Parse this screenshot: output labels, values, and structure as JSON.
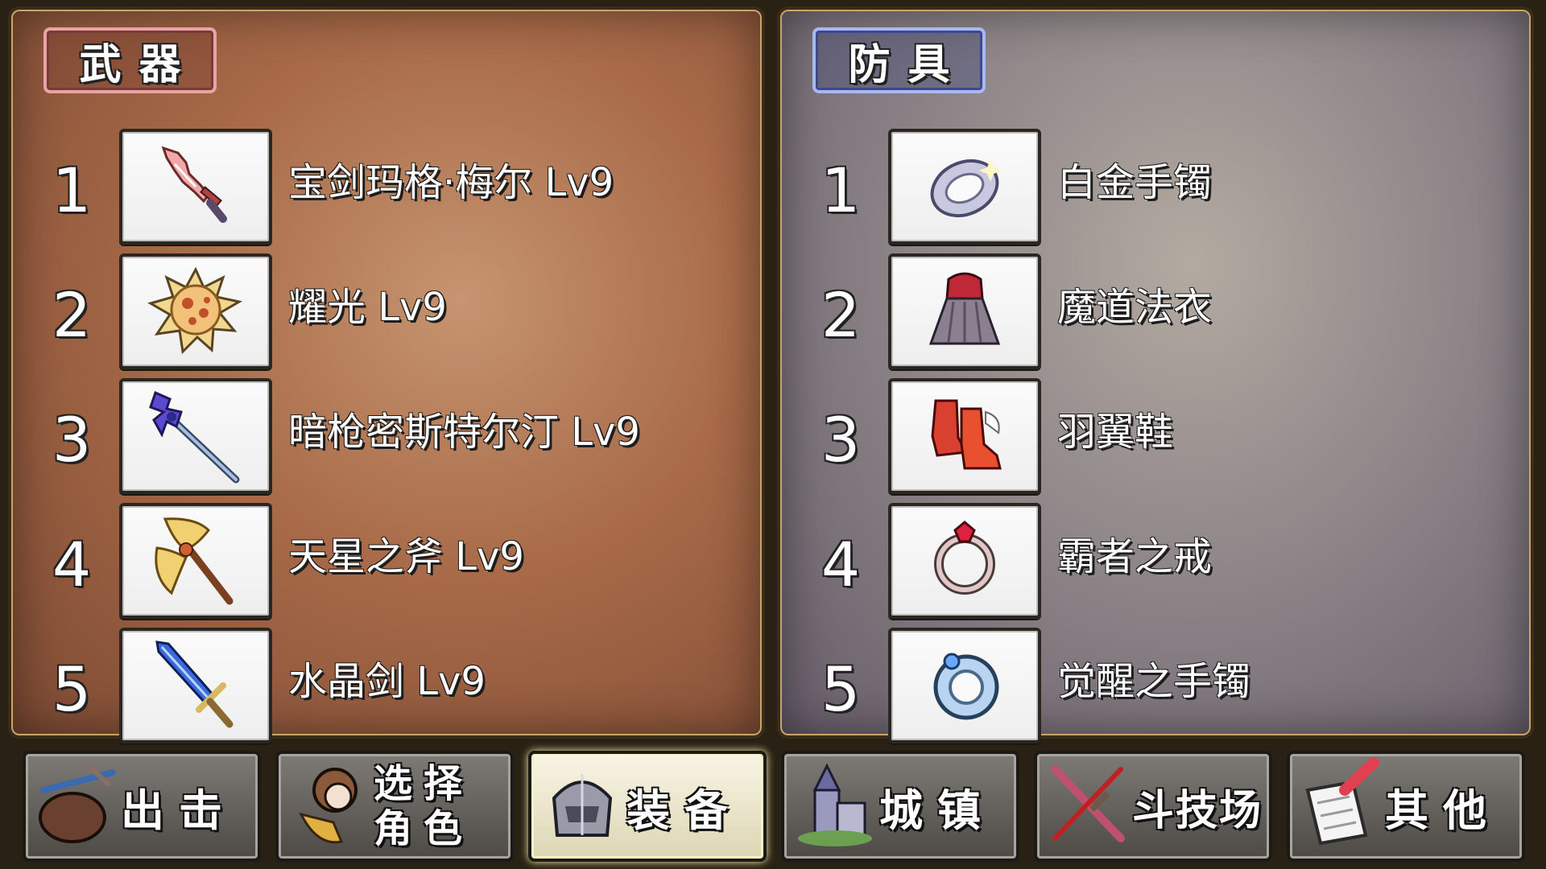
{
  "weapons": {
    "title": "武器",
    "items": [
      {
        "num": "1",
        "name": "宝剑玛格·梅尔 Lv9",
        "icon": "sword-icon"
      },
      {
        "num": "2",
        "name": "耀光 Lv9",
        "icon": "flare-orb-icon"
      },
      {
        "num": "3",
        "name": "暗枪密斯特尔汀 Lv9",
        "icon": "spear-icon"
      },
      {
        "num": "4",
        "name": "天星之斧 Lv9",
        "icon": "axe-icon"
      },
      {
        "num": "5",
        "name": "水晶剑 Lv9",
        "icon": "crystal-sword-icon"
      }
    ]
  },
  "armor": {
    "title": "防具",
    "items": [
      {
        "num": "1",
        "name": "白金手镯",
        "icon": "bracelet-icon"
      },
      {
        "num": "2",
        "name": "魔道法衣",
        "icon": "robe-icon"
      },
      {
        "num": "3",
        "name": "羽翼鞋",
        "icon": "boots-icon"
      },
      {
        "num": "4",
        "name": "霸者之戒",
        "icon": "ring-icon"
      },
      {
        "num": "5",
        "name": "觉醒之手镯",
        "icon": "bangle-icon"
      }
    ]
  },
  "menu": {
    "sortie": "出击",
    "select_character": "选择\n角色",
    "equip": "装备",
    "town": "城镇",
    "arena": "斗技场",
    "other": "其他",
    "active": "equip"
  },
  "colors": {
    "weapons_accent": "#e8a4a4",
    "armor_accent": "#a8b8f2"
  }
}
